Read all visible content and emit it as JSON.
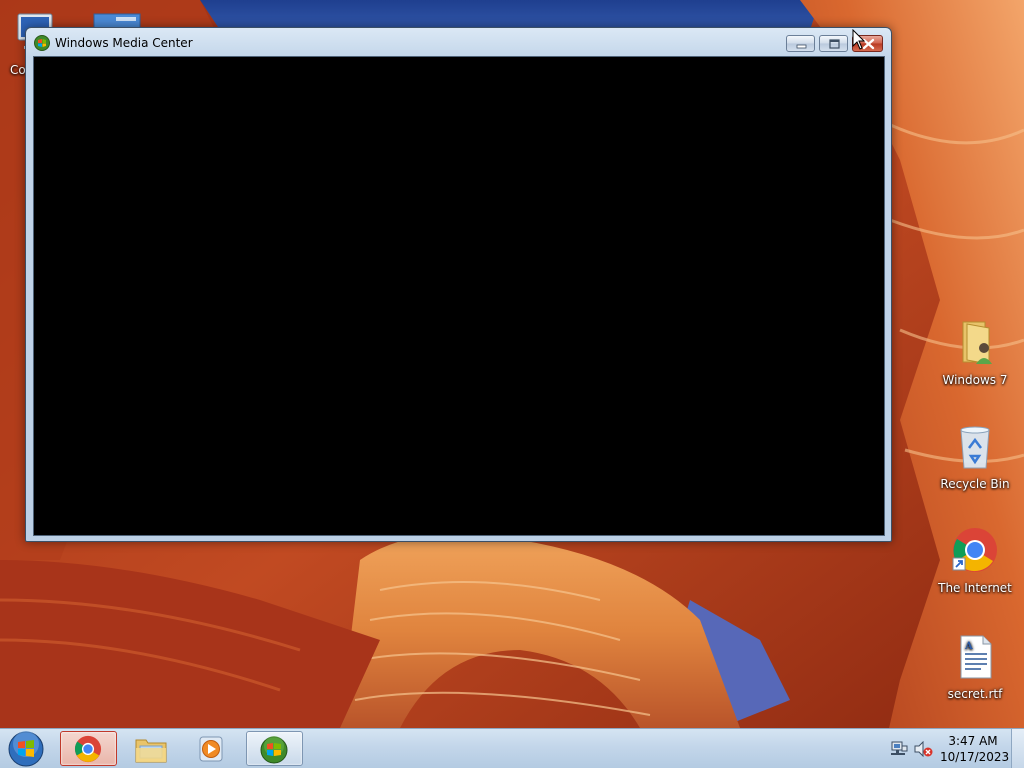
{
  "window": {
    "title": "Windows Media Center",
    "buttons": [
      "minimize",
      "maximize",
      "close"
    ]
  },
  "desktop_icons": [
    {
      "label": "Co",
      "icon": "computer-icon"
    },
    {
      "label": "Windows 7",
      "icon": "user-folder-icon"
    },
    {
      "label": "Recycle Bin",
      "icon": "recycle-bin-icon"
    },
    {
      "label": "The Internet",
      "icon": "chrome-shortcut-icon"
    },
    {
      "label": "secret.rtf",
      "icon": "rtf-document-icon"
    }
  ],
  "taskbar": {
    "start": "windows-start-orb",
    "pinned": [
      {
        "name": "Google Chrome",
        "icon": "chrome-icon",
        "active": true
      },
      {
        "name": "Windows Explorer",
        "icon": "folder-icon",
        "active": false
      },
      {
        "name": "Windows Media Player",
        "icon": "media-player-icon",
        "active": false
      },
      {
        "name": "Windows Media Center",
        "icon": "media-center-icon",
        "active": true
      }
    ],
    "tray": {
      "network": "network-icon",
      "volume": "volume-muted-icon",
      "time": "3:47 AM",
      "date": "10/17/2023"
    }
  },
  "colors": {
    "wallpaper_sky": "#2b4f9c",
    "wallpaper_rock": "#c4532a",
    "window_client": "#000000",
    "taskbar": "#c3d6ea",
    "close_button": "#c9462f"
  }
}
